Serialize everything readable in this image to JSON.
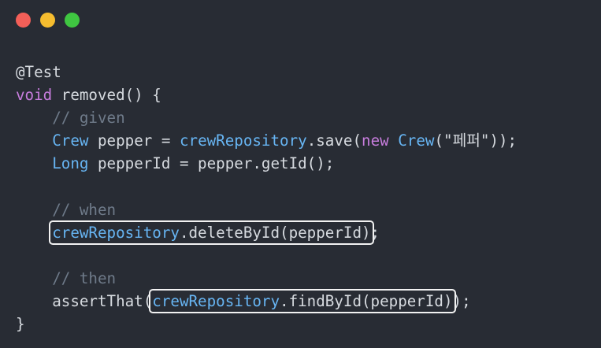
{
  "window": {
    "controls": [
      {
        "name": "close",
        "color": "#f45f58"
      },
      {
        "name": "minimize",
        "color": "#f6bd2f"
      },
      {
        "name": "zoom",
        "color": "#3fc641"
      }
    ]
  },
  "colors": {
    "plain": "#d7dbe0",
    "keyword": "#c77ddd",
    "type": "#67b5f3",
    "comment": "#6f7b8a",
    "string": "#98c379",
    "annotation": "#d7dbe0",
    "highlight_box": "#f2f2f2"
  },
  "code": {
    "lines": [
      [
        {
          "t": "@Test",
          "c": "annotation"
        }
      ],
      [
        {
          "t": "void",
          "c": "keyword"
        },
        {
          "t": " removed() {",
          "c": "plain"
        }
      ],
      [
        {
          "t": "    ",
          "c": "plain"
        },
        {
          "t": "// given",
          "c": "comment"
        }
      ],
      [
        {
          "t": "    ",
          "c": "plain"
        },
        {
          "t": "Crew",
          "c": "type"
        },
        {
          "t": " pepper = ",
          "c": "plain"
        },
        {
          "t": "crewRepository",
          "c": "type"
        },
        {
          "t": ".save(",
          "c": "plain"
        },
        {
          "t": "new",
          "c": "keyword"
        },
        {
          "t": " ",
          "c": "plain"
        },
        {
          "t": "Crew",
          "c": "type"
        },
        {
          "t": "(",
          "c": "plain"
        },
        {
          "t": "\"페퍼\"",
          "c": "plain"
        },
        {
          "t": "));",
          "c": "plain"
        }
      ],
      [
        {
          "t": "    ",
          "c": "plain"
        },
        {
          "t": "Long",
          "c": "type"
        },
        {
          "t": " pepperId = pepper.getId();",
          "c": "plain"
        }
      ],
      [],
      [
        {
          "t": "    ",
          "c": "plain"
        },
        {
          "t": "// when",
          "c": "comment"
        }
      ],
      [
        {
          "t": "    ",
          "c": "plain"
        },
        {
          "hl": [
            {
              "t": "crewRepository",
              "c": "type"
            },
            {
              "t": ".deleteById(pepperId)",
              "c": "plain"
            }
          ]
        },
        {
          "t": ";",
          "c": "plain"
        }
      ],
      [],
      [
        {
          "t": "    ",
          "c": "plain"
        },
        {
          "t": "// then",
          "c": "comment"
        }
      ],
      [
        {
          "t": "    ",
          "c": "plain"
        },
        {
          "t": "assertThat(",
          "c": "plain"
        },
        {
          "hl": [
            {
              "t": "crewRepository",
              "c": "type"
            },
            {
              "t": ".findById(pepperId)",
              "c": "plain"
            }
          ]
        },
        {
          "t": ");",
          "c": "plain"
        }
      ],
      [
        {
          "t": "}",
          "c": "plain"
        }
      ]
    ]
  }
}
